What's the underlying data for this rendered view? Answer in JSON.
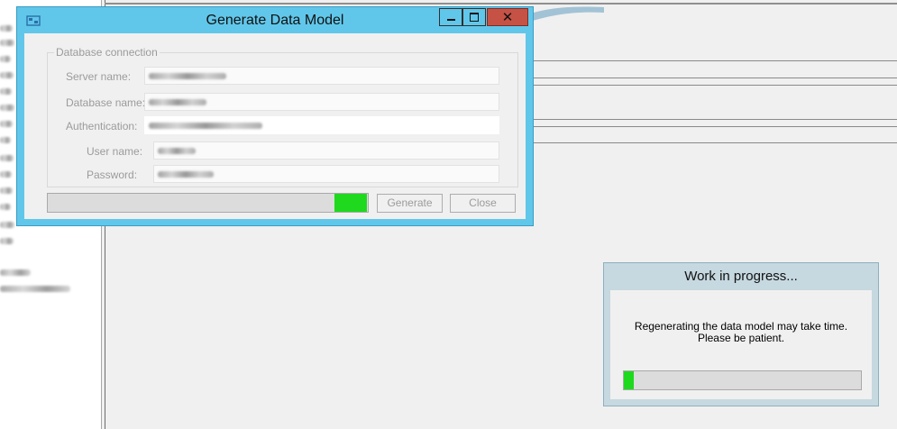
{
  "dialog": {
    "title": "Generate Data Model",
    "icon": "database-model-icon",
    "caption_buttons": {
      "minimize": "minimize-icon",
      "maximize": "maximize-icon",
      "close": "close-icon"
    },
    "group_title": "Database connection",
    "fields": {
      "server_label": "Server name:",
      "database_label": "Database name:",
      "authentication_label": "Authentication:",
      "username_label": "User name:",
      "password_label": "Password:"
    },
    "progress_fraction": 0.1,
    "generate_label": "Generate",
    "close_label": "Close"
  },
  "work_in_progress": {
    "title": "Work in  progress...",
    "message_line1": "Regenerating the data model may take time.",
    "message_line2": "Please be patient.",
    "progress_fraction": 0.04
  },
  "colors": {
    "title_bar": "#61c7ea",
    "close_button": "#c65245",
    "progress_fill": "#1ed91e",
    "window_background": "#f0f0f0"
  }
}
